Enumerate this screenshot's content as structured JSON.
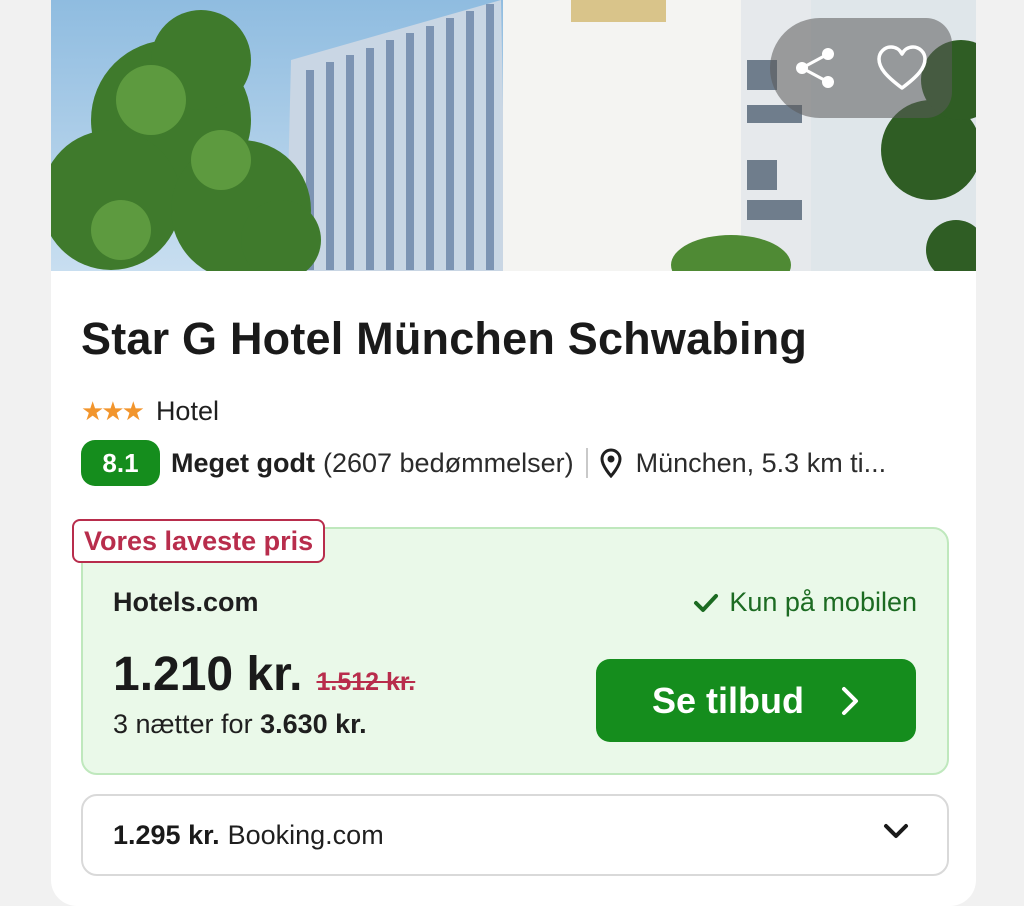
{
  "hero": {
    "share_icon": "share-icon",
    "favorite_icon": "heart-icon"
  },
  "hotel": {
    "name": "Star G Hotel München Schwabing",
    "stars": "★★★",
    "type": "Hotel",
    "score": "8.1",
    "rating_word": "Meget godt",
    "review_count": "(2607 bedømmelser)",
    "location": "München, 5.3 km ti..."
  },
  "offer": {
    "tag": "Vores laveste pris",
    "provider": "Hotels.com",
    "mobile_only": "Kun på mobilen",
    "price": "1.210 kr.",
    "old_price": "1.512 kr.",
    "nights_prefix": "3 nætter for",
    "nights_total": "3.630 kr.",
    "cta_label": "Se tilbud"
  },
  "alt_offer": {
    "price": "1.295 kr.",
    "provider": "Booking.com"
  },
  "colors": {
    "brand_green": "#158d1d",
    "deal_red": "#b82d4c",
    "offer_bg": "#eaf9e9",
    "star_orange": "#f2952c"
  }
}
